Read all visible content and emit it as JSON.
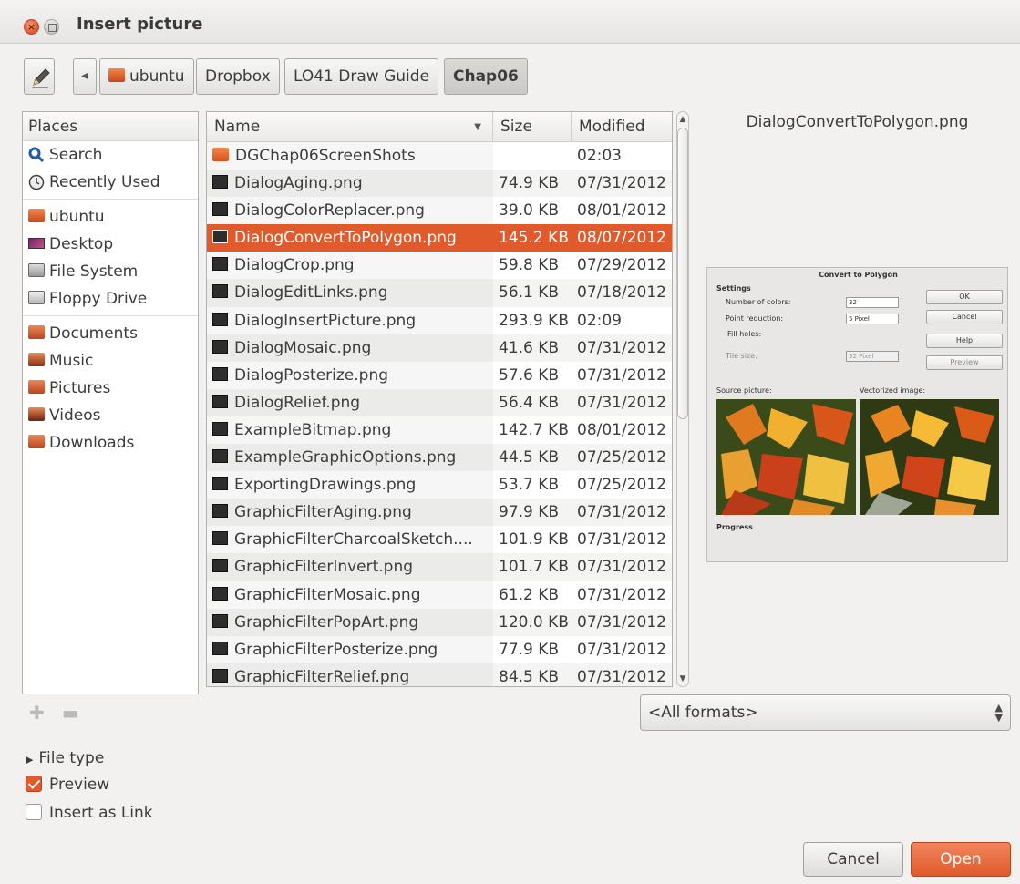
{
  "window": {
    "title": "Insert picture"
  },
  "path": {
    "crumbs": [
      "ubuntu",
      "Dropbox",
      "LO41 Draw Guide",
      "Chap06"
    ],
    "active": "Chap06"
  },
  "places": {
    "header": "Places",
    "items": [
      {
        "label": "Search",
        "icon": "search-icon"
      },
      {
        "label": "Recently Used",
        "icon": "recent-icon"
      },
      {
        "label": "ubuntu",
        "icon": "home-folder-icon"
      },
      {
        "label": "Desktop",
        "icon": "desktop-icon"
      },
      {
        "label": "File System",
        "icon": "filesystem-icon"
      },
      {
        "label": "Floppy Drive",
        "icon": "floppy-icon"
      },
      {
        "label": "Documents",
        "icon": "documents-icon"
      },
      {
        "label": "Music",
        "icon": "music-icon"
      },
      {
        "label": "Pictures",
        "icon": "pictures-icon"
      },
      {
        "label": "Videos",
        "icon": "videos-icon"
      },
      {
        "label": "Downloads",
        "icon": "downloads-icon"
      }
    ]
  },
  "files": {
    "columns": {
      "name": "Name",
      "size": "Size",
      "modified": "Modified"
    },
    "rows": [
      {
        "name": "DGChap06ScreenShots",
        "size": "",
        "modified": "02:03",
        "type": "folder"
      },
      {
        "name": "DialogAging.png",
        "size": "74.9 KB",
        "modified": "07/31/2012",
        "type": "image"
      },
      {
        "name": "DialogColorReplacer.png",
        "size": "39.0 KB",
        "modified": "08/01/2012",
        "type": "image"
      },
      {
        "name": "DialogConvertToPolygon.png",
        "size": "145.2 KB",
        "modified": "08/07/2012",
        "type": "image",
        "selected": true
      },
      {
        "name": "DialogCrop.png",
        "size": "59.8 KB",
        "modified": "07/29/2012",
        "type": "image"
      },
      {
        "name": "DialogEditLinks.png",
        "size": "56.1 KB",
        "modified": "07/18/2012",
        "type": "image"
      },
      {
        "name": "DialogInsertPicture.png",
        "size": "293.9 KB",
        "modified": "02:09",
        "type": "image"
      },
      {
        "name": "DialogMosaic.png",
        "size": "41.6 KB",
        "modified": "07/31/2012",
        "type": "image"
      },
      {
        "name": "DialogPosterize.png",
        "size": "57.6 KB",
        "modified": "07/31/2012",
        "type": "image"
      },
      {
        "name": "DialogRelief.png",
        "size": "56.4 KB",
        "modified": "07/31/2012",
        "type": "image"
      },
      {
        "name": "ExampleBitmap.png",
        "size": "142.7 KB",
        "modified": "08/01/2012",
        "type": "image"
      },
      {
        "name": "ExampleGraphicOptions.png",
        "size": "44.5 KB",
        "modified": "07/25/2012",
        "type": "image"
      },
      {
        "name": "ExportingDrawings.png",
        "size": "53.7 KB",
        "modified": "07/25/2012",
        "type": "image"
      },
      {
        "name": "GraphicFilterAging.png",
        "size": "97.9 KB",
        "modified": "07/31/2012",
        "type": "image"
      },
      {
        "name": "GraphicFilterCharcoalSketch....",
        "size": "101.9 KB",
        "modified": "07/31/2012",
        "type": "image"
      },
      {
        "name": "GraphicFilterInvert.png",
        "size": "101.7 KB",
        "modified": "07/31/2012",
        "type": "image"
      },
      {
        "name": "GraphicFilterMosaic.png",
        "size": "61.2 KB",
        "modified": "07/31/2012",
        "type": "image"
      },
      {
        "name": "GraphicFilterPopArt.png",
        "size": "120.0 KB",
        "modified": "07/31/2012",
        "type": "image"
      },
      {
        "name": "GraphicFilterPosterize.png",
        "size": "77.9 KB",
        "modified": "07/31/2012",
        "type": "image"
      },
      {
        "name": "GraphicFilterRelief.png",
        "size": "84.5 KB",
        "modified": "07/31/2012",
        "type": "image"
      }
    ]
  },
  "preview": {
    "filename": "DialogConvertToPolygon.png",
    "thumb": {
      "title": "Convert to Polygon",
      "settings": "Settings",
      "number_of_colors_label": "Number of colors:",
      "number_of_colors_value": "32",
      "point_reduction_label": "Point reduction:",
      "point_reduction_value": "5 Pixel",
      "fill_holes_label": "Fill holes:",
      "tile_size_label": "Tile size:",
      "tile_size_value": "32 Pixel",
      "ok": "OK",
      "cancel": "Cancel",
      "help": "Help",
      "preview": "Preview",
      "source_label": "Source picture:",
      "vectorized_label": "Vectorized image:",
      "progress_label": "Progress"
    }
  },
  "filter": {
    "selected": "<All formats>"
  },
  "options": {
    "file_type": "File type",
    "preview": "Preview",
    "preview_checked": true,
    "insert_as_link": "Insert as Link",
    "insert_as_link_checked": false
  },
  "buttons": {
    "cancel": "Cancel",
    "open": "Open"
  },
  "colors": {
    "accent": "#e05a2b",
    "background": "#f2f1f0"
  }
}
